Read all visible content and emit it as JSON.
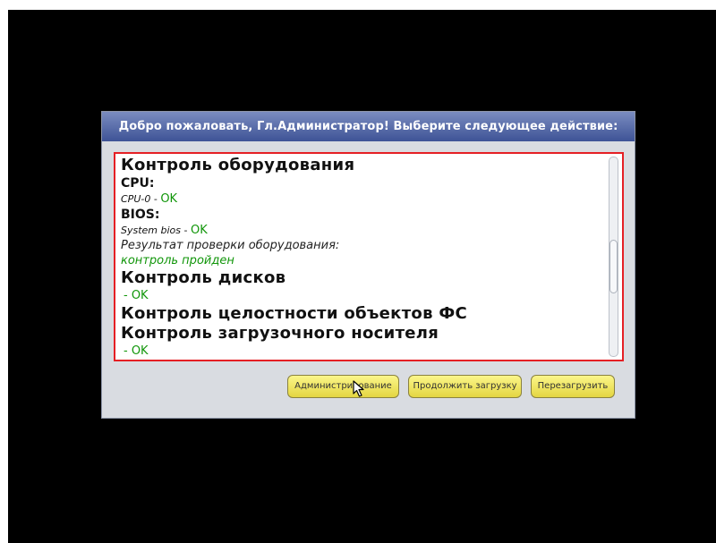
{
  "dialog": {
    "title": "Добро пожаловать, Гл.Администратор! Выберите следующее действие:"
  },
  "report": {
    "hw_heading": "Контроль оборудования",
    "cpu_label": "CPU:",
    "cpu_item": "CPU-0",
    "cpu_status": "OK",
    "bios_label": "BIOS:",
    "bios_item": "System bios",
    "bios_status": "OK",
    "hw_result_label": "Результат проверки оборудования:",
    "hw_result_value": "контроль пройден",
    "disk_heading": "Контроль дисков",
    "disk_status": "- OK",
    "fs_heading": "Контроль целостности объектов ФС",
    "boot_heading": "Контроль загрузочного носителя",
    "boot_status": "- OK",
    "separator": " - "
  },
  "buttons": {
    "admin": "Администрирование",
    "continue": "Продолжить загрузку",
    "reboot": "Перезагрузить"
  },
  "icons": {
    "cursor": "mouse-pointer-icon"
  }
}
